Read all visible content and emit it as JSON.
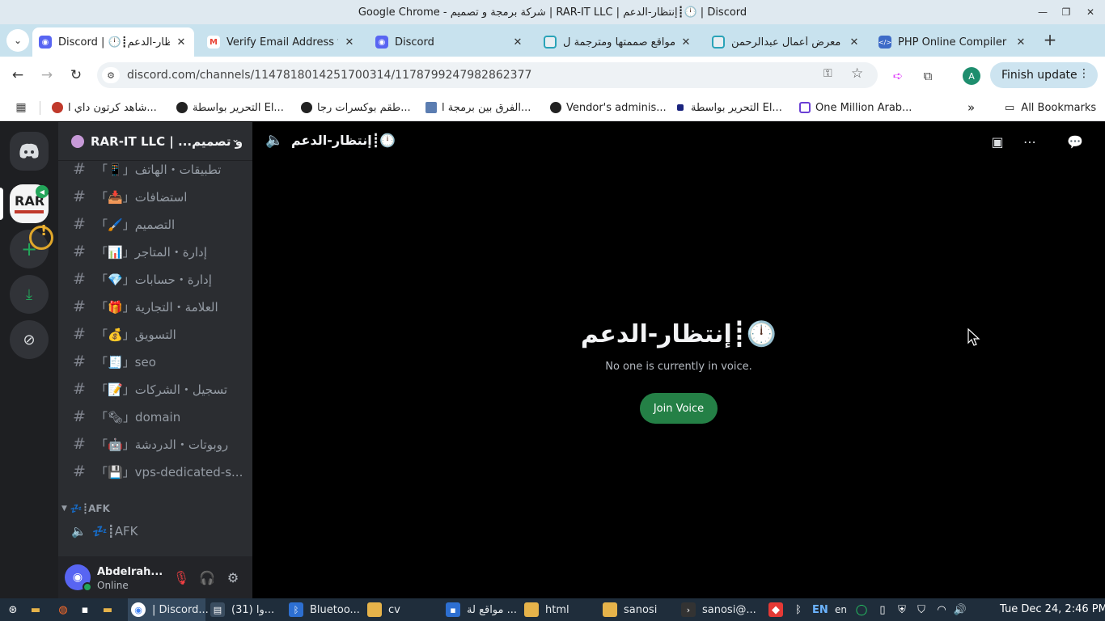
{
  "window": {
    "title": "Google Chrome - شركة برمجة و تصميم | RAR-IT LLC | إنتظار-الدعم┋🕛 | Discord"
  },
  "tabs": [
    {
      "label": "Discord | 🕛┋إنتظار-الدعم",
      "icon": "discord-icon",
      "active": true
    },
    {
      "label": "Verify Email Address fo",
      "icon": "gmail-icon",
      "active": false
    },
    {
      "label": "Discord",
      "icon": "discord-icon",
      "active": false
    },
    {
      "label": "مواقع صممتها ومترجمة ل",
      "icon": "site-icon",
      "active": false
    },
    {
      "label": "معرض أعمال عبدالرحمن",
      "icon": "site-icon",
      "active": false
    },
    {
      "label": "PHP Online Compiler",
      "icon": "code-icon",
      "active": false
    }
  ],
  "toolbar": {
    "url": "discord.com/channels/1147818014251700314/1178799247982862377",
    "avatar_letter": "A",
    "finish_update": "Finish update"
  },
  "bookmarks": [
    "شاهد كرتون داي ا...",
    "التحرير بواسطة El...",
    "طقم بوكسرات رجا...",
    "الفرق بين برمجة ا...",
    "Vendor's adminis...",
    "التحرير بواسطة El...",
    "One Million Arab..."
  ],
  "bookmarks_all": "All Bookmarks",
  "discord": {
    "guild_name": "RAR-IT LLC | ...و تصميم",
    "channels": [
      "「📱」تطبيقات・الهاتف",
      "「📥」استضافات",
      "「🖌️」التصميم",
      "「📊」إدارة・المتاجر",
      "「💎」إدارة・حسابات",
      "「🎁」العلامة・التجارية",
      "「💰」التسويق",
      "「🧾」seo",
      "「📝」تسجيل・الشركات",
      "「🗞」domain",
      "「🤖」روبوتات・الدردشة",
      "「💾」vps-dedicated-s..."
    ],
    "category": "💤┋AFK",
    "voice_channel": "💤┋AFK",
    "user": {
      "name": "Abdelrah...",
      "status": "Online"
    },
    "header_title": "إنتظار-الدعم┋🕛",
    "center_title": "إنتظار-الدعم┋🕛",
    "center_subtitle": "No one is currently in voice.",
    "join_button": "Join Voice"
  },
  "taskbar": {
    "items": [
      "| Discord...",
      "(31) وا...",
      "Bluetoo...",
      "cv",
      "مواقع لة ...",
      "html",
      "sanosi",
      "sanosi@..."
    ],
    "lang1": "EN",
    "lang2": "en",
    "clock": "Tue Dec 24,  2:46 PM"
  },
  "colors": {
    "tab_strip": "#c8e2ee",
    "discord_green": "#248046",
    "discord_rail": "#1e1f22",
    "discord_sidebar": "#2b2d31",
    "taskbar": "#1f2d3b"
  }
}
